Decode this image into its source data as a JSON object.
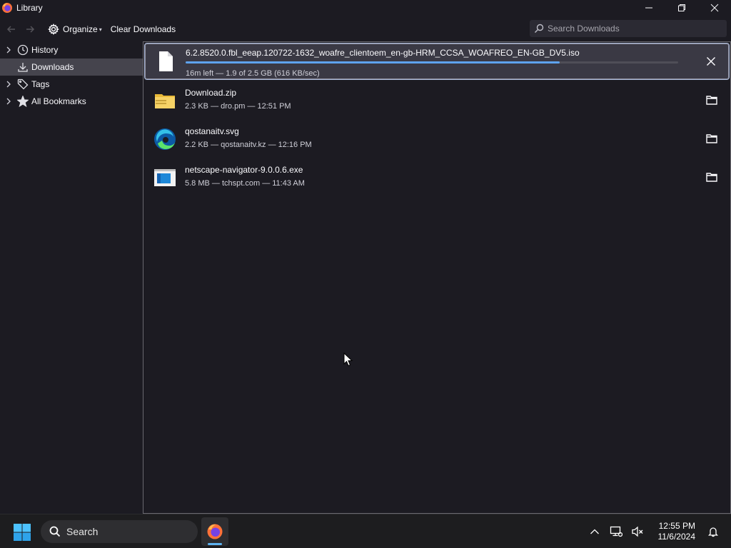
{
  "window": {
    "title": "Library"
  },
  "toolbar": {
    "organize_label": "Organize",
    "clear_label": "Clear Downloads",
    "search_placeholder": "Search Downloads"
  },
  "sidebar": {
    "items": [
      {
        "label": "History",
        "icon": "clock-icon",
        "expandable": true,
        "selected": false
      },
      {
        "label": "Downloads",
        "icon": "download-icon",
        "expandable": false,
        "selected": true
      },
      {
        "label": "Tags",
        "icon": "tag-icon",
        "expandable": true,
        "selected": false
      },
      {
        "label": "All Bookmarks",
        "icon": "star-icon",
        "expandable": true,
        "selected": false
      }
    ]
  },
  "downloads": [
    {
      "name": "6.2.8520.0.fbl_eeap.120722-1632_woafre_clientoem_en-gb-HRM_CCSA_WOAFREO_EN-GB_DV5.iso",
      "status": "16m left — 1.9 of 2.5 GB (616 KB/sec)",
      "icon": "file-icon",
      "in_progress": true,
      "progress": 0.76,
      "action": "cancel-icon"
    },
    {
      "name": "Download.zip",
      "status": "2.3 KB — dro.pm — 12:51 PM",
      "icon": "zip-folder-icon",
      "in_progress": false,
      "action": "folder-icon"
    },
    {
      "name": "qostanaitv.svg",
      "status": "2.2 KB — qostanaitv.kz — 12:16 PM",
      "icon": "edge-icon",
      "in_progress": false,
      "action": "folder-icon"
    },
    {
      "name": "netscape-navigator-9.0.0.6.exe",
      "status": "5.8 MB — tchspt.com — 11:43 AM",
      "icon": "exe-icon",
      "in_progress": false,
      "action": "folder-icon"
    }
  ],
  "taskbar": {
    "search_label": "Search",
    "time": "12:55 PM",
    "date": "11/6/2024"
  },
  "colors": {
    "background": "#1c1b22",
    "selected": "#45444d",
    "accent": "#5ea3ef"
  }
}
